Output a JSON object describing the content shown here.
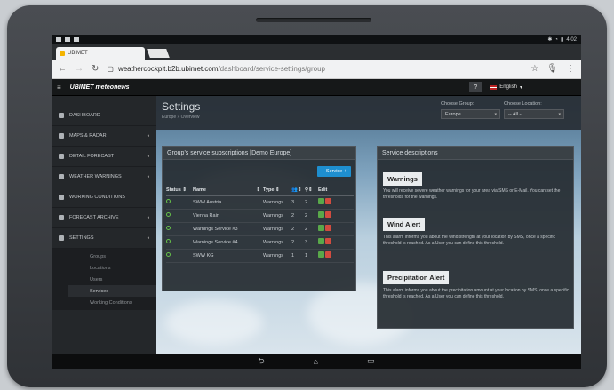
{
  "status_bar": {
    "time": "4:02"
  },
  "browser": {
    "tab_title": "UBIMET",
    "url_host": "weathercockpit.b2b.ubimet.com",
    "url_path": "/dashboard/service-settings/group"
  },
  "appbar": {
    "logo_text": "UBIMET meteonews",
    "help": "?",
    "language": "English"
  },
  "sidebar": {
    "items": [
      {
        "label": "DASHBOARD",
        "icon": "dashboard-icon"
      },
      {
        "label": "MAPS & RADAR",
        "icon": "map-pin-icon"
      },
      {
        "label": "DETAIL FORECAST",
        "icon": "chart-icon"
      },
      {
        "label": "WEATHER WARNINGS",
        "icon": "warning-icon"
      },
      {
        "label": "WORKING CONDITIONS",
        "icon": "gears-icon"
      },
      {
        "label": "FORECAST ARCHIVE",
        "icon": "archive-icon"
      },
      {
        "label": "SETTINGS",
        "icon": "users-icon"
      }
    ],
    "submenu": [
      "Groups",
      "Locations",
      "Users",
      "Services",
      "Working Conditions"
    ]
  },
  "header": {
    "title": "Settings",
    "breadcrumb": "Europe » Overview",
    "group_label": "Choose Group:",
    "group_value": "Europe",
    "location_label": "Choose Location:",
    "location_value": "-- All --"
  },
  "subscriptions": {
    "title": "Group's service subscriptions [Demo Europe]",
    "add_button": "Service +",
    "columns": [
      "Status",
      "Name",
      "Type",
      "",
      "",
      "Edit"
    ],
    "rows": [
      {
        "name": "SWW Austria",
        "type": "Warnings",
        "c1": "3",
        "c2": "2"
      },
      {
        "name": "Vienna Rain",
        "type": "Warnings",
        "c1": "2",
        "c2": "2"
      },
      {
        "name": "Warnings Service #3",
        "type": "Warnings",
        "c1": "2",
        "c2": "2"
      },
      {
        "name": "Warnings Service #4",
        "type": "Warnings",
        "c1": "2",
        "c2": "3"
      },
      {
        "name": "SWW KG",
        "type": "Warnings",
        "c1": "1",
        "c2": "1"
      }
    ]
  },
  "descriptions": {
    "title": "Service descriptions",
    "sections": [
      {
        "heading": "Warnings",
        "text": "You will receive severe weather warnings for your area via SMS or E-Mail. You can set the thresholds for the warnings."
      },
      {
        "heading": "Wind Alert",
        "text": "This alarm informs you about the wind strength at your location by SMS, once a specific threshold is reached. As a User you can define this threshold."
      },
      {
        "heading": "Precipitation Alert",
        "text": "This alarm informs you about the precipitation amount at your location by SMS, once a specific threshold is reached. As a User you can define this threshold."
      }
    ]
  },
  "colors": {
    "accent": "#1e8fd0",
    "status_ok": "#66c14a",
    "delete": "#d24c3f"
  }
}
